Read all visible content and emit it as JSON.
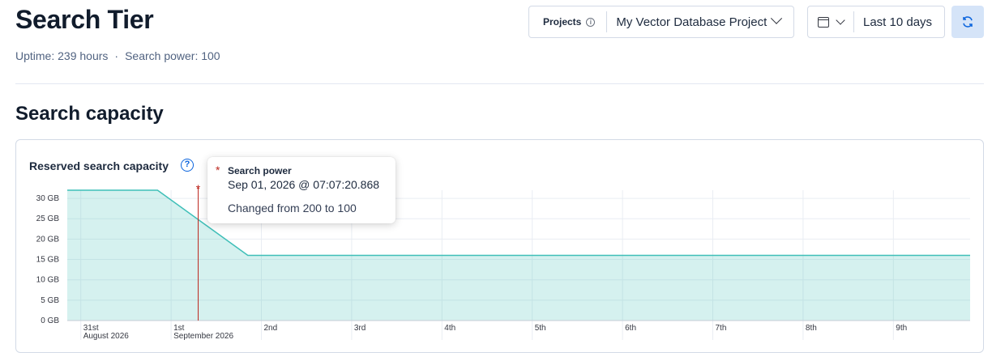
{
  "header": {
    "title": "Search Tier",
    "uptime": "Uptime: 239 hours",
    "separator": "·",
    "search_power": "Search power: 100"
  },
  "projects": {
    "label": "Projects",
    "info_icon": "info-icon",
    "selected": "My Vector Database Project"
  },
  "date_picker": {
    "icon": "calendar-icon",
    "value": "Last 10 days"
  },
  "refresh": {
    "icon": "refresh-icon"
  },
  "section": {
    "title": "Search capacity"
  },
  "panel": {
    "title": "Reserved search capacity",
    "help_icon": "?"
  },
  "tooltip": {
    "marker": "*",
    "name": "Search power",
    "time": "Sep 01, 2026 @ 07:07:20.868",
    "description": "Changed from 200 to 100"
  },
  "chart_data": {
    "type": "area",
    "title": "Reserved search capacity",
    "y_unit": "GB",
    "ylim": [
      0,
      32
    ],
    "y_ticks": [
      "0 GB",
      "5 GB",
      "10 GB",
      "15 GB",
      "20 GB",
      "25 GB",
      "30 GB"
    ],
    "y_tick_values": [
      0,
      5,
      10,
      15,
      20,
      25,
      30
    ],
    "x_ticks": [
      {
        "day": 0.0,
        "label": "31st",
        "sublabel": "August 2026"
      },
      {
        "day": 1.0,
        "label": "1st",
        "sublabel": "September 2026"
      },
      {
        "day": 2.0,
        "label": "2nd",
        "sublabel": ""
      },
      {
        "day": 3.0,
        "label": "3rd",
        "sublabel": ""
      },
      {
        "day": 4.0,
        "label": "4th",
        "sublabel": ""
      },
      {
        "day": 5.0,
        "label": "5th",
        "sublabel": ""
      },
      {
        "day": 6.0,
        "label": "6th",
        "sublabel": ""
      },
      {
        "day": 7.0,
        "label": "7th",
        "sublabel": ""
      },
      {
        "day": 8.0,
        "label": "8th",
        "sublabel": ""
      },
      {
        "day": 9.0,
        "label": "9th",
        "sublabel": ""
      }
    ],
    "xlim": [
      -0.15,
      9.85
    ],
    "series": [
      {
        "color": "#3fbfb8",
        "x": [
          -0.15,
          0.85,
          1.85,
          9.85
        ],
        "y": [
          32,
          32,
          16,
          16
        ]
      }
    ],
    "annotation": {
      "x": 1.3,
      "marker": "*",
      "color": "#bd271e"
    },
    "grid": true
  }
}
